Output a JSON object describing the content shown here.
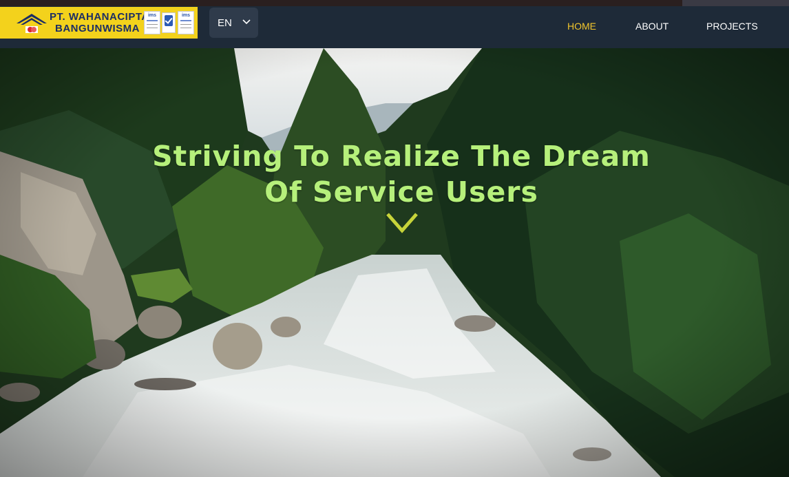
{
  "brand": {
    "name_line1": "PT. WAHANACIPTA",
    "name_line2": "BANGUNWISMA",
    "cert_label": "ims",
    "color": "#f3d21c",
    "text_color": "#1c2e64"
  },
  "language": {
    "selected": "EN",
    "icon": "chevron-down-icon"
  },
  "nav": {
    "items": [
      {
        "label": "HOME",
        "active": true
      },
      {
        "label": "ABOUT",
        "active": false
      },
      {
        "label": "PROJECTS",
        "active": false
      }
    ],
    "active_color": "#f2c62d"
  },
  "hero": {
    "title_line1": "Striving To Realize The Dream",
    "title_line2": "Of Service Users",
    "title_color": "#b6f07b",
    "scroll_icon": "chevron-down-icon",
    "scroll_icon_color": "#c7d43a"
  }
}
